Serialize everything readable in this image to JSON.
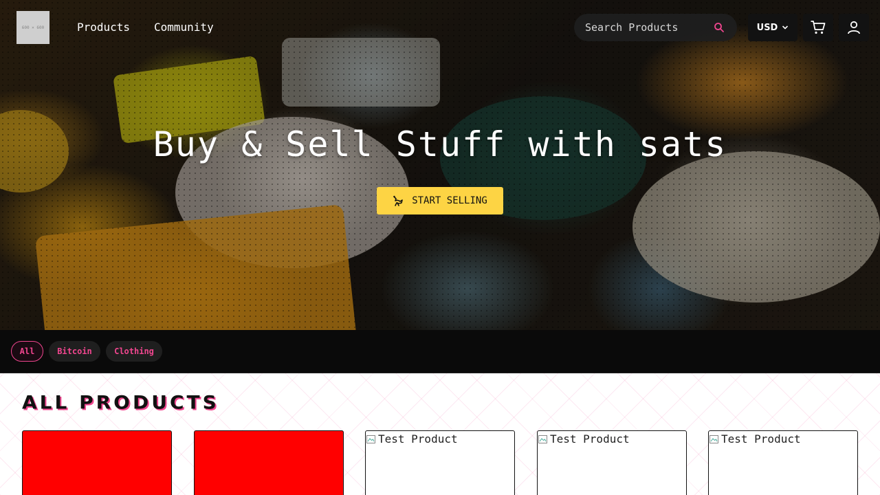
{
  "nav": {
    "logo_text": "600 × 600",
    "links": [
      "Products",
      "Community"
    ],
    "search_placeholder": "Search Products",
    "currency": "USD"
  },
  "hero": {
    "title": "Buy & Sell Stuff with sats",
    "cta_label": "START SELLING"
  },
  "filters": {
    "chips": [
      "All",
      "Bitcoin",
      "Clothing"
    ],
    "active": "All"
  },
  "products": {
    "section_title": "ALL PRODUCTS",
    "cards": [
      {
        "alt": ""
      },
      {
        "alt": ""
      },
      {
        "alt": "Test Product"
      },
      {
        "alt": "Test Product"
      },
      {
        "alt": "Test Product"
      }
    ]
  },
  "colors": {
    "accent": "#f0468f",
    "cta": "#fdd444",
    "placeholder_red": "#ff0000"
  }
}
